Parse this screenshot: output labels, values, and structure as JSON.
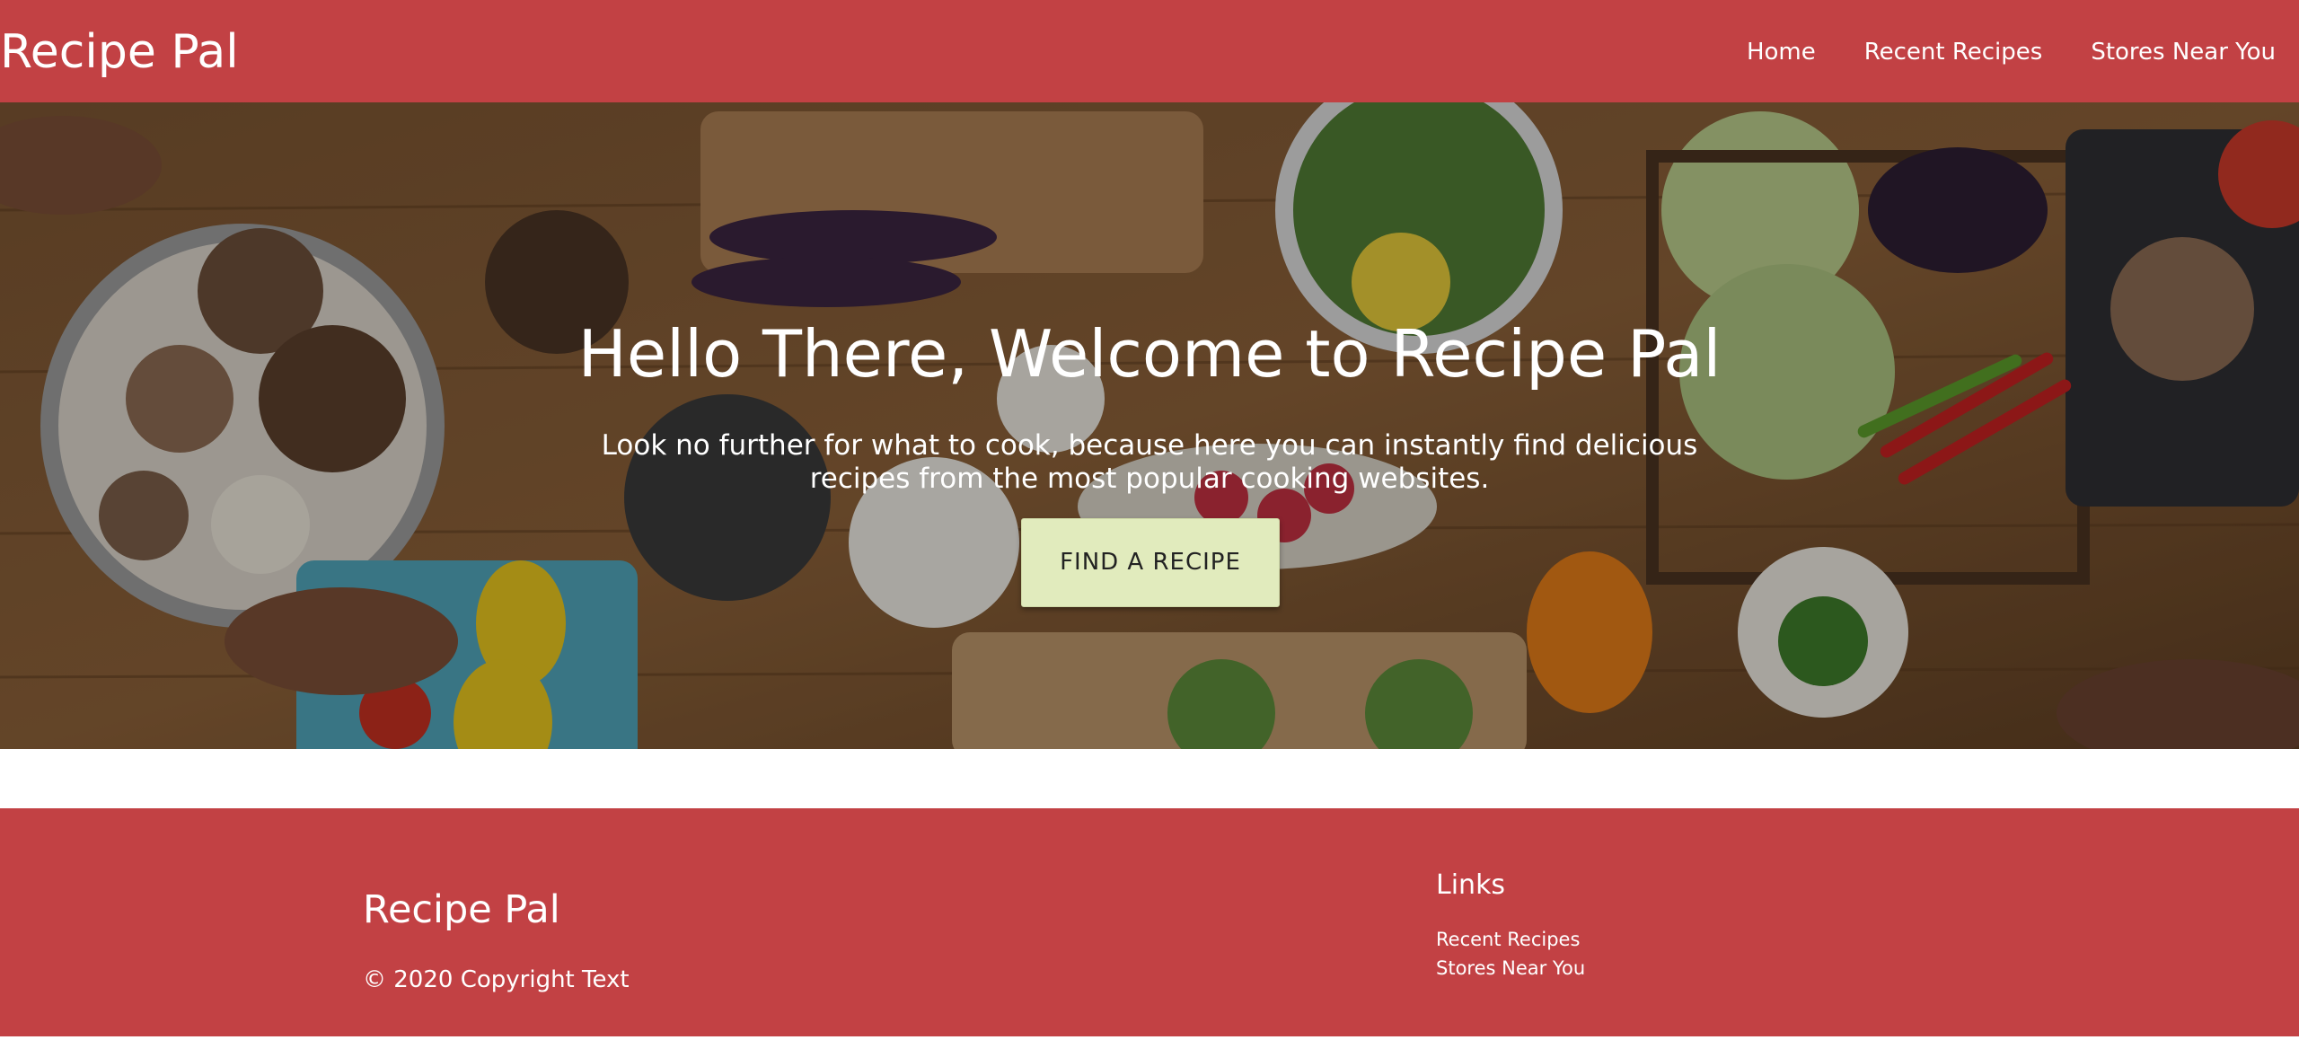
{
  "navbar": {
    "brand": "Recipe Pal",
    "links": [
      {
        "label": "Home"
      },
      {
        "label": "Recent Recipes"
      },
      {
        "label": "Stores Near You"
      }
    ]
  },
  "hero": {
    "title": "Hello There, Welcome to Recipe Pal",
    "subtitle": "Look no further for what to cook, because here you can instantly find delicious recipes from the most popular cooking websites.",
    "cta_label": "FIND A RECIPE"
  },
  "footer": {
    "brand": "Recipe Pal",
    "copyright": "© 2020 Copyright Text",
    "links_title": "Links",
    "links": [
      {
        "label": "Recent Recipes"
      },
      {
        "label": "Stores Near You"
      }
    ]
  },
  "colors": {
    "brand_red": "#c24144",
    "cta_background": "#e1ebbd",
    "text_light": "#ffffff"
  },
  "icons": [
    "food-background-image"
  ]
}
